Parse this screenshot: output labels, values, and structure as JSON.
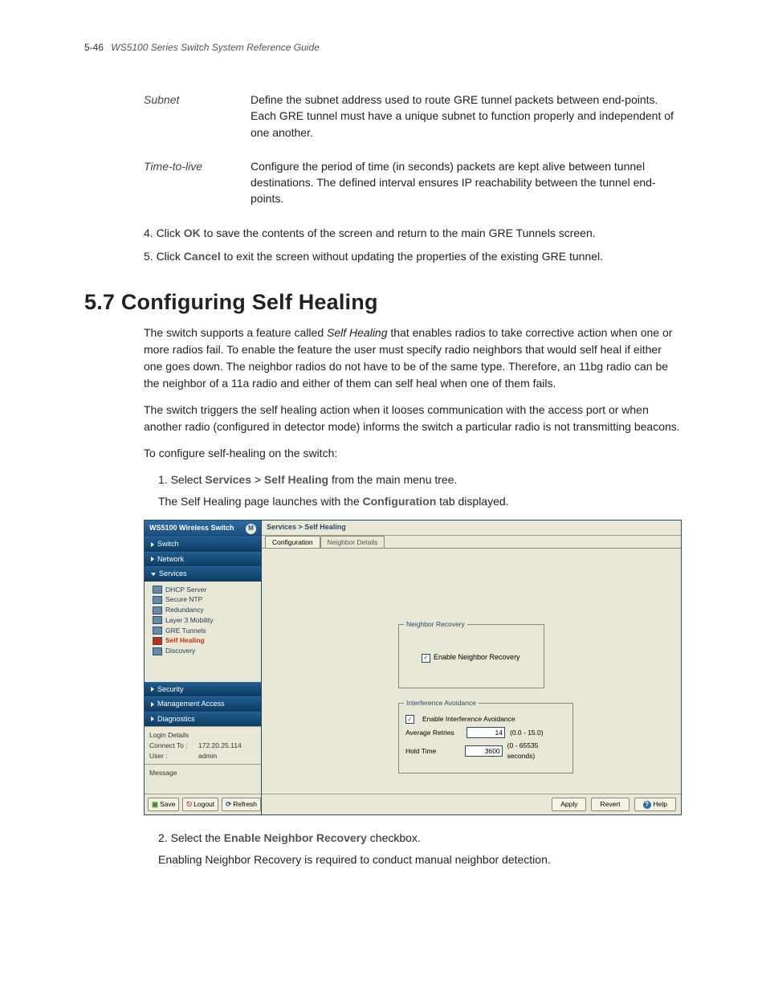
{
  "header": {
    "page": "5-46",
    "title": "WS5100 Series Switch System Reference Guide"
  },
  "defs": {
    "subnet": {
      "term": "Subnet",
      "desc": "Define the subnet address used to route GRE tunnel packets between end-points. Each GRE tunnel must have a unique subnet to function properly and independent of one another."
    },
    "ttl": {
      "term": "Time-to-live",
      "desc": "Configure the period of time (in seconds) packets are kept alive between tunnel destinations. The defined interval ensures IP reachability between the tunnel end-points."
    }
  },
  "steps_a": {
    "s4_pre": "4. Click ",
    "s4_b": "OK",
    "s4_post": " to save the contents of the screen and return to the main GRE Tunnels screen.",
    "s5_pre": "5. Click ",
    "s5_b": "Cancel",
    "s5_post": " to exit the screen without updating the properties of the existing GRE tunnel."
  },
  "section": {
    "num": "5.7",
    "title": "Configuring Self Healing"
  },
  "para": {
    "p1a": "The switch supports a feature called ",
    "p1em": "Self Healing",
    "p1b": " that enables radios to take corrective action when one or more radios fail. To enable the feature the user must specify radio neighbors that would self heal if either one goes down. The neighbor radios do not have to be of the same type. Therefore, an 11bg radio can be the neighbor of a 11a radio and either of them can self heal when one of them fails.",
    "p2": "The switch triggers the self healing action when it looses communication with the access port or when another radio (configured in detector mode) informs the switch a particular radio is not transmitting beacons.",
    "p3": "To configure self-healing on the switch:"
  },
  "steps_b": {
    "s1_pre": "1. Select ",
    "s1_b1": "Services",
    "s1_gt": " > ",
    "s1_b2": "Self Healing",
    "s1_post": " from the main menu tree.",
    "s1_sub_pre": "The Self Healing page launches with the ",
    "s1_sub_b": "Configuration",
    "s1_sub_post": " tab displayed.",
    "s2_pre": "2. Select the ",
    "s2_b": "Enable Neighbor Recovery",
    "s2_post": " checkbox.",
    "s2_sub": "Enabling Neighbor Recovery is required to conduct manual neighbor detection."
  },
  "app": {
    "brand": "WS5100 Wireless Switch",
    "logo": "M",
    "nav": {
      "switch": "Switch",
      "network": "Network",
      "services": "Services",
      "security": "Security",
      "mgmt": "Management Access",
      "diag": "Diagnostics"
    },
    "tree": {
      "dhcp": "DHCP Server",
      "ntp": "Secure NTP",
      "redun": "Redundancy",
      "l3": "Layer 3 Mobility",
      "gre": "GRE Tunnels",
      "self": "Self Healing",
      "disc": "Discovery"
    },
    "login": {
      "title": "Login Details",
      "connect_l": "Connect To :",
      "connect_v": "172.20.25.114",
      "user_l": "User :",
      "user_v": "admin"
    },
    "msg": "Message",
    "btns": {
      "save": "Save",
      "logout": "Logout",
      "refresh": "Refresh"
    },
    "crumb": "Services > Self Healing",
    "tabs": {
      "cfg": "Configuration",
      "nbr": "Neighbor Details"
    },
    "grp1": {
      "legend": "Neighbor Recovery",
      "chk": "Enable Neighbor Recovery"
    },
    "grp2": {
      "legend": "Interference Avoidance",
      "chk": "Enable Interference Avoidance",
      "retries_l": "Average Retries",
      "retries_v": "14",
      "retries_r": "(0.0 - 15.0)",
      "hold_l": "Hold Time",
      "hold_v": "3600",
      "hold_r": "(0 - 65535 seconds)"
    },
    "actions": {
      "apply": "Apply",
      "revert": "Revert",
      "help": "Help"
    }
  }
}
